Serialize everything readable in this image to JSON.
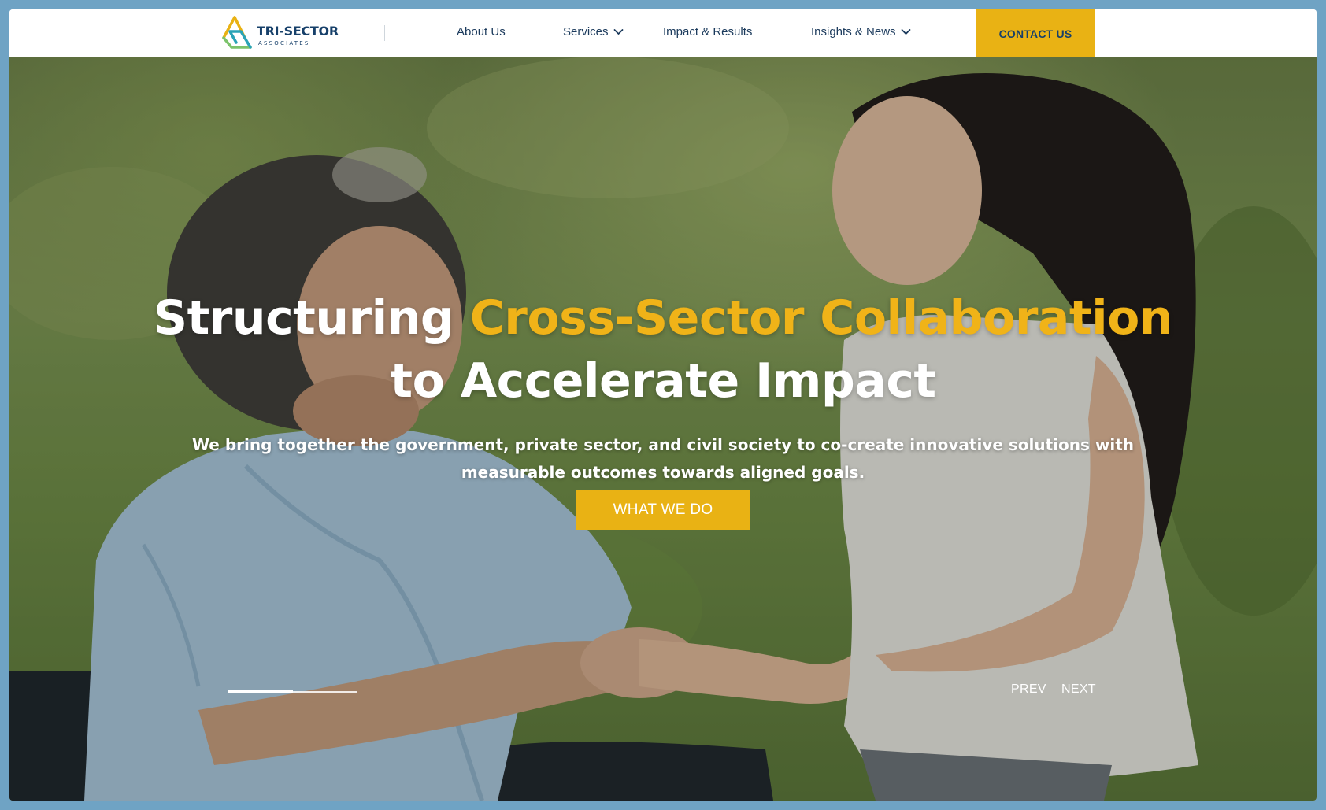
{
  "brand": {
    "name": "TRI-SECTOR",
    "tagline": "ASSOCIATES",
    "colors": {
      "primary": "#17406a",
      "accent": "#e9b214",
      "teal": "#2aa3b6",
      "green": "#7cc36b"
    }
  },
  "nav": {
    "items": [
      {
        "label": "About Us",
        "has_dropdown": false
      },
      {
        "label": "Services",
        "has_dropdown": true
      },
      {
        "label": "Impact & Results",
        "has_dropdown": false
      },
      {
        "label": "Insights & News",
        "has_dropdown": true
      }
    ],
    "contact_label": "CONTACT US"
  },
  "hero": {
    "title_part1": "Structuring ",
    "title_accent": "Cross-Sector Collaboration",
    "title_line2": "to Accelerate Impact",
    "subtitle": "We bring together the government, private sector, and civil society to co-create innovative solutions with measurable outcomes towards aligned goals.",
    "cta_label": "WHAT WE DO"
  },
  "slider": {
    "prev_label": "PREV",
    "next_label": "NEXT",
    "progress": 0.5
  }
}
